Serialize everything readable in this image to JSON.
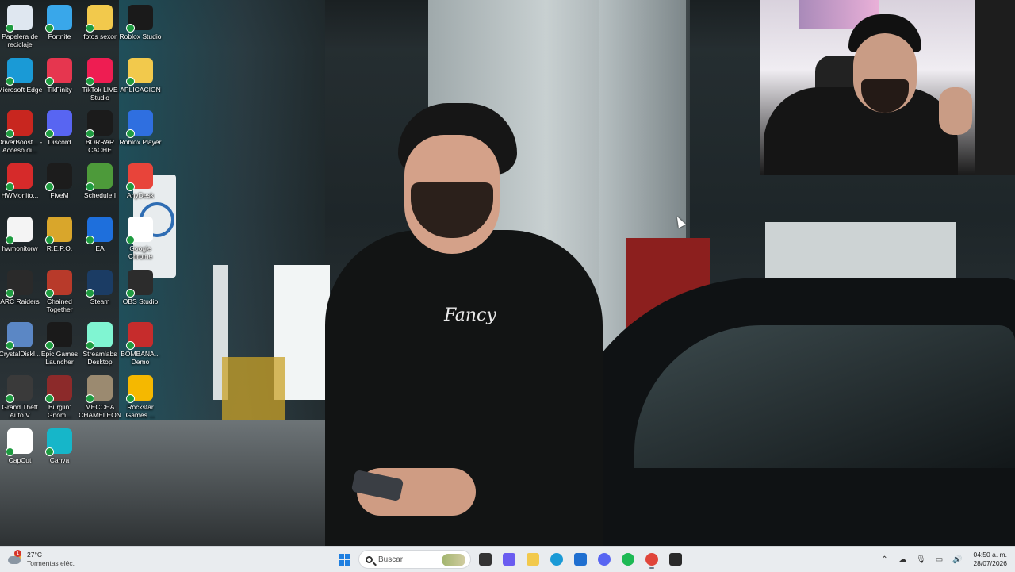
{
  "desktop": {
    "icons": [
      {
        "label": "Papelera de reciclaje",
        "icon": "recycle-bin-icon",
        "color": "#dfe7f0"
      },
      {
        "label": "Fortnite",
        "icon": "fortnite-icon",
        "color": "#39a7ea"
      },
      {
        "label": "fotos sexor",
        "icon": "folder-icon",
        "color": "#f2c94c"
      },
      {
        "label": "Roblox Studio",
        "icon": "roblox-studio-icon",
        "color": "#1a1a1a"
      },
      {
        "label": "Microsoft Edge",
        "icon": "edge-icon",
        "color": "#1a9ad6"
      },
      {
        "label": "TikFinity",
        "icon": "tikfinity-icon",
        "color": "#e6364f"
      },
      {
        "label": "TikTok LIVE Studio",
        "icon": "tiktok-live-icon",
        "color": "#ee1d52"
      },
      {
        "label": "APLICACION",
        "icon": "folder-icon",
        "color": "#f2c94c"
      },
      {
        "label": "DriverBoost... - Acceso di...",
        "icon": "driver-booster-icon",
        "color": "#c8261f"
      },
      {
        "label": "Discord",
        "icon": "discord-icon",
        "color": "#5865f2"
      },
      {
        "label": "BORRAR CACHE",
        "icon": "terminal-icon",
        "color": "#1b1b1b"
      },
      {
        "label": "Roblox Player",
        "icon": "roblox-icon",
        "color": "#2f6fe0"
      },
      {
        "label": "HWMonito...",
        "icon": "hwmonitor-icon",
        "color": "#d62a2a"
      },
      {
        "label": "FiveM",
        "icon": "fivem-icon",
        "color": "#1c1c1c"
      },
      {
        "label": "Schedule I",
        "icon": "schedule-i-icon",
        "color": "#4d9a3a"
      },
      {
        "label": "AnyDesk",
        "icon": "anydesk-icon",
        "color": "#e8443a"
      },
      {
        "label": "hwmonitorw",
        "icon": "document-icon",
        "color": "#f4f4f4"
      },
      {
        "label": "R.E.P.O.",
        "icon": "repo-icon",
        "color": "#d9a62b"
      },
      {
        "label": "EA",
        "icon": "ea-icon",
        "color": "#1e6fdc"
      },
      {
        "label": "Google Chrome",
        "icon": "chrome-icon",
        "color": "#ffffff"
      },
      {
        "label": "ARC Raiders",
        "icon": "arc-raiders-icon",
        "color": "#2a2a2a"
      },
      {
        "label": "Chained Together",
        "icon": "chained-together-icon",
        "color": "#b83a2a"
      },
      {
        "label": "Steam",
        "icon": "steam-icon",
        "color": "#1b3c64"
      },
      {
        "label": "OBS Studio",
        "icon": "obs-icon",
        "color": "#2c2c2c"
      },
      {
        "label": "CrystalDiskI...",
        "icon": "crystaldisk-icon",
        "color": "#5b87c5"
      },
      {
        "label": "Epic Games Launcher",
        "icon": "epic-games-icon",
        "color": "#1a1a1a"
      },
      {
        "label": "Streamlabs Desktop",
        "icon": "streamlabs-icon",
        "color": "#80f5d2"
      },
      {
        "label": "BOMBANA... Demo",
        "icon": "bombana-icon",
        "color": "#c62c2c"
      },
      {
        "label": "Grand Theft Auto V",
        "icon": "gta-v-icon",
        "color": "#3a3a3a"
      },
      {
        "label": "Burglin' Gnom...",
        "icon": "burglin-gnomes-icon",
        "color": "#8c2a2a"
      },
      {
        "label": "MECCHA CHAMELEON",
        "icon": "meccha-chameleon-icon",
        "color": "#9b8a70"
      },
      {
        "label": "Rockstar Games ...",
        "icon": "rockstar-icon",
        "color": "#f5b800"
      },
      {
        "label": "CapCut",
        "icon": "capcut-icon",
        "color": "#ffffff"
      },
      {
        "label": "Canva",
        "icon": "canva-icon",
        "color": "#16b6c9"
      }
    ]
  },
  "wallpaper": {
    "shirt_logo": "Fancy"
  },
  "taskbar": {
    "weather": {
      "temp": "27°C",
      "desc": "Tormentas eléc.",
      "badge": "1"
    },
    "search_placeholder": "Buscar",
    "apps": [
      {
        "name": "task-view-icon",
        "color": "#333333"
      },
      {
        "name": "copilot-icon",
        "color": "#6a5cf0"
      },
      {
        "name": "file-explorer-icon",
        "color": "#f2c94c"
      },
      {
        "name": "edge-taskbar-icon",
        "color": "#1a9ad6"
      },
      {
        "name": "store-icon",
        "color": "#1f6fd0"
      },
      {
        "name": "discord-taskbar-icon",
        "color": "#5865f2"
      },
      {
        "name": "spotify-icon",
        "color": "#1db954"
      },
      {
        "name": "chrome-taskbar-icon",
        "color": "#e0453a"
      },
      {
        "name": "app-badge-icon",
        "color": "#2a2a2a"
      }
    ],
    "clock": {
      "time": "04:50 a. m.",
      "date": "28/07/2026"
    }
  }
}
